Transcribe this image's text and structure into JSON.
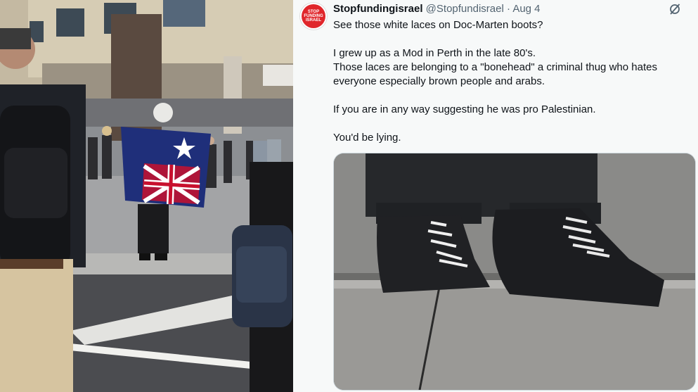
{
  "post": {
    "avatar_text": [
      "STOP",
      "FUNDING",
      "ISRAEL"
    ],
    "display_name": "Stopfundingisrael",
    "handle": "@Stopfundisrael",
    "separator": "·",
    "date": "Aug 4",
    "paragraphs": [
      "See those white laces on Doc-Marten boots?",
      "I grew up as a Mod in Perth in the late 80's.\nThose laces are belonging to a \"bonehead\" a criminal thug who hates everyone especially brown people and arabs.",
      "If you are in any way suggesting he was pro Palestinian.",
      "You'd be lying."
    ]
  },
  "icons": {
    "grok": "grok-slash-icon"
  },
  "colors": {
    "text": "#0f1419",
    "secondary": "#536471",
    "avatar_red": "#e0262b",
    "flag_blue": "#1f2f7a",
    "flag_red": "#c8102e"
  }
}
